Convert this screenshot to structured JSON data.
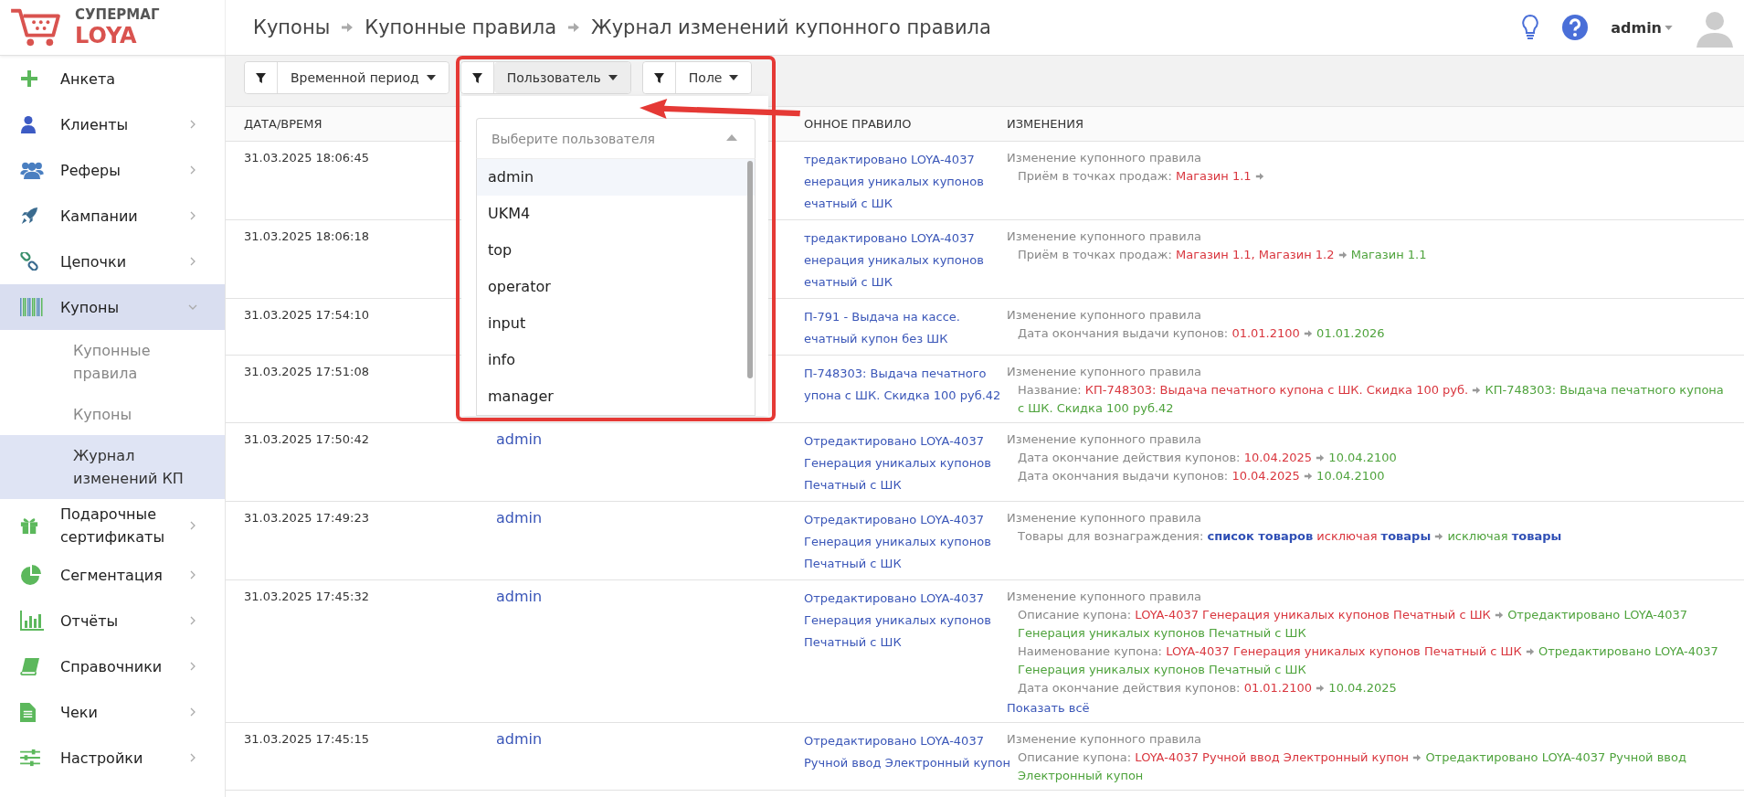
{
  "logo": {
    "top": "СУПЕРМАГ",
    "bottom": "LOYA"
  },
  "breadcrumbs": [
    "Купоны",
    "Купонные правила",
    "Журнал изменений купонного правила"
  ],
  "user_menu": {
    "name": "admin"
  },
  "sidebar": {
    "items": [
      {
        "label": "Анкета",
        "selected": false
      },
      {
        "label": "Клиенты",
        "selected": false,
        "expanded": false
      },
      {
        "label": "Реферы",
        "selected": false,
        "expanded": false
      },
      {
        "label": "Кампании",
        "selected": false,
        "expanded": false
      },
      {
        "label": "Цепочки",
        "selected": false,
        "expanded": false
      },
      {
        "label": "Купоны",
        "selected": true,
        "expanded": true,
        "children": [
          {
            "label": "Купонные правила",
            "selected": false
          },
          {
            "label": "Купоны",
            "selected": false
          },
          {
            "label": "Журнал изменений КП",
            "selected": true
          }
        ]
      },
      {
        "label": "Подарочные сертификаты",
        "selected": false,
        "expanded": false
      },
      {
        "label": "Сегментация",
        "selected": false,
        "expanded": false
      },
      {
        "label": "Отчёты",
        "selected": false,
        "expanded": false
      },
      {
        "label": "Справочники",
        "selected": false,
        "expanded": false
      },
      {
        "label": "Чеки",
        "selected": false,
        "expanded": false
      },
      {
        "label": "Настройки",
        "selected": false,
        "expanded": false
      }
    ]
  },
  "filters": [
    {
      "label": "Временной период",
      "open": false
    },
    {
      "label": "Пользователь",
      "open": true
    },
    {
      "label": "Поле",
      "open": false
    }
  ],
  "user_dropdown": {
    "placeholder": "Выберите пользователя",
    "options": [
      {
        "label": "admin",
        "highlighted": true
      },
      {
        "label": "UKM4",
        "highlighted": false
      },
      {
        "label": "top",
        "highlighted": false
      },
      {
        "label": "operator",
        "highlighted": false
      },
      {
        "label": "input",
        "highlighted": false
      },
      {
        "label": "info",
        "highlighted": false
      },
      {
        "label": "manager",
        "highlighted": false
      }
    ]
  },
  "table": {
    "columns": [
      "ДАТА/ВРЕМЯ",
      "ОННОЕ ПРАВИЛО",
      "ИЗМЕНЕНИЯ"
    ],
    "rows": [
      {
        "datetime": "31.03.2025 18:06:45",
        "rule": [
          "тредактировано LOYA-4037",
          "енерация уникалых купонов",
          "ечатный с ШК"
        ],
        "changes": {
          "title": "Изменение купонного правила",
          "items": [
            {
              "label": "Приём в точках продаж:",
              "old": "Магазин 1.1"
            }
          ]
        }
      },
      {
        "datetime": "31.03.2025 18:06:18",
        "rule": [
          "тредактировано LOYA-4037",
          "енерация уникалых купонов",
          "ечатный с ШК"
        ],
        "changes": {
          "title": "Изменение купонного правила",
          "items": [
            {
              "label": "Приём в точках продаж:",
              "old": "Магазин 1.1, Магазин 1.2",
              "new": "Магазин 1.1"
            }
          ]
        }
      },
      {
        "datetime": "31.03.2025 17:54:10",
        "rule": [
          "П-791 - Выдача на кассе.",
          "ечатный купон без ШК"
        ],
        "changes": {
          "title": "Изменение купонного правила",
          "items": [
            {
              "label": "Дата окончания выдачи купонов:",
              "old": "01.01.2100",
              "new": "01.01.2026"
            }
          ]
        }
      },
      {
        "datetime": "31.03.2025 17:51:08",
        "rule": [
          "П-748303: Выдача печатного",
          "упона с ШК. Скидка 100 руб.42"
        ],
        "changes": {
          "title": "Изменение купонного правила",
          "items": [
            {
              "label": "Название:",
              "old": "КП-748303: Выдача печатного купона с ШК. Скидка 100 руб.",
              "new": "КП-748303: Выдача печатного купона с ШК. Скидка 100 руб.42"
            }
          ]
        }
      },
      {
        "datetime": "31.03.2025 17:50:42",
        "user": "admin",
        "rule": [
          "Отредактировано LOYA-4037",
          "Генерация уникалых купонов",
          "Печатный с ШК"
        ],
        "changes": {
          "title": "Изменение купонного правила",
          "items": [
            {
              "label": "Дата окончание действия купонов:",
              "old": "10.04.2025",
              "new": "10.04.2100"
            },
            {
              "label": "Дата окончания выдачи купонов:",
              "old": "10.04.2025",
              "new": "10.04.2100"
            }
          ]
        }
      },
      {
        "datetime": "31.03.2025 17:49:23",
        "user": "admin",
        "rule": [
          "Отредактировано LOYA-4037",
          "Генерация уникалых купонов",
          "Печатный с ШК"
        ],
        "changes": {
          "title": "Изменение купонного правила",
          "items": [
            {
              "label": "Товары для вознаграждения:",
              "old": "**список товаров** исключая **товары**",
              "new": "исключая **товары**"
            }
          ]
        }
      },
      {
        "datetime": "31.03.2025 17:45:32",
        "user": "admin",
        "rule": [
          "Отредактировано LOYA-4037",
          "Генерация уникалых купонов",
          "Печатный с ШК"
        ],
        "changes": {
          "title": "Изменение купонного правила",
          "items": [
            {
              "label": "Описание купона:",
              "old": "LOYA-4037 Генерация уникалых купонов Печатный с ШК",
              "new": "Отредактировано LOYA-4037 Генерация уникалых купонов Печатный с ШК"
            },
            {
              "label": "Наименование купона:",
              "old": "LOYA-4037 Генерация уникалых купонов Печатный с ШК",
              "new": "Отредактировано LOYA-4037 Генерация уникалых купонов Печатный с ШК"
            },
            {
              "label": "Дата окончание действия купонов:",
              "old": "01.01.2100",
              "new": "10.04.2025"
            }
          ],
          "show_all": "Показать всё"
        }
      },
      {
        "datetime": "31.03.2025 17:45:15",
        "user": "admin",
        "rule": [
          "Отредактировано LOYA-4037",
          "Ручной ввод Электронный купон"
        ],
        "changes": {
          "title": "Изменение купонного правила",
          "items": [
            {
              "label": "Описание купона:",
              "old": "LOYA-4037 Ручной ввод Электронный купон",
              "new": "Отредактировано LOYA-4037 Ручной ввод Электронный купон"
            }
          ]
        }
      }
    ]
  }
}
